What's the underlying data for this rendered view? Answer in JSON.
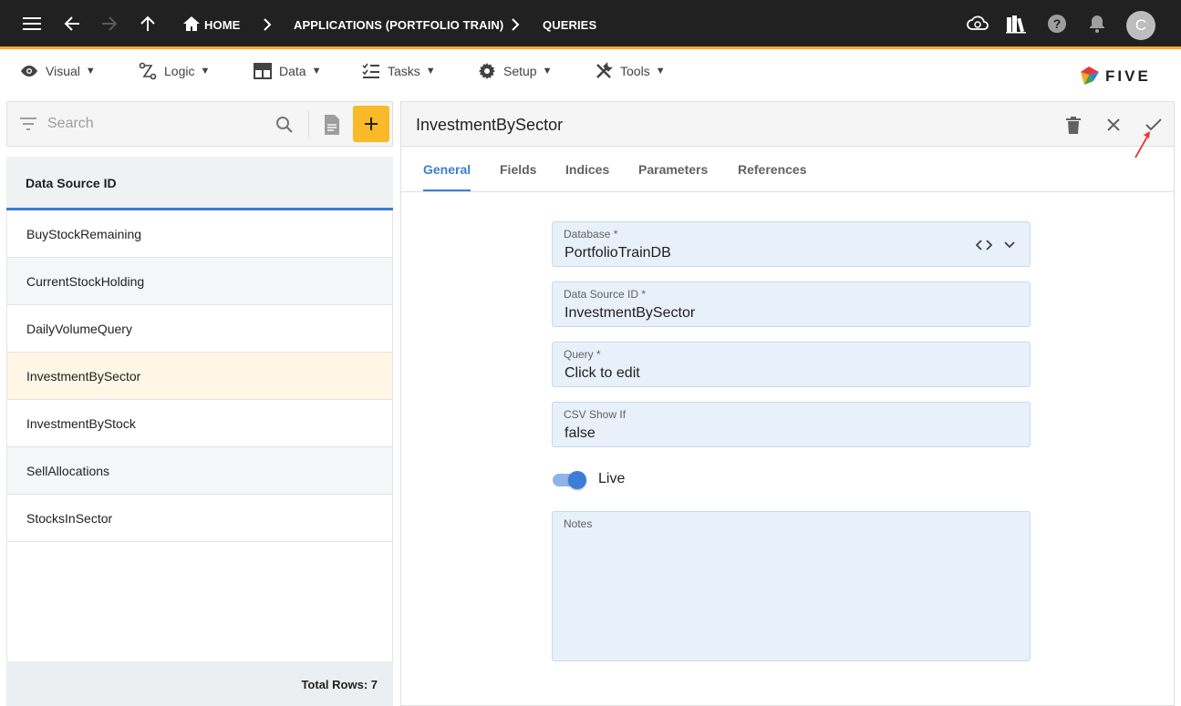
{
  "topbar": {
    "breadcrumbs": [
      "HOME",
      "APPLICATIONS (PORTFOLIO TRAIN)",
      "QUERIES"
    ],
    "avatar_initial": "C"
  },
  "menu": {
    "items": [
      {
        "label": "Visual",
        "icon": "eye-icon"
      },
      {
        "label": "Logic",
        "icon": "logic-icon"
      },
      {
        "label": "Data",
        "icon": "table-icon"
      },
      {
        "label": "Tasks",
        "icon": "tasks-icon"
      },
      {
        "label": "Setup",
        "icon": "gear-icon"
      },
      {
        "label": "Tools",
        "icon": "tools-icon"
      }
    ],
    "caret": "▼",
    "logo_text": "FIVE"
  },
  "sidebar": {
    "search_placeholder": "Search",
    "column_header": "Data Source ID",
    "items": [
      "BuyStockRemaining",
      "CurrentStockHolding",
      "DailyVolumeQuery",
      "InvestmentBySector",
      "InvestmentByStock",
      "SellAllocations",
      "StocksInSector"
    ],
    "selected_index": 3,
    "footer": "Total Rows: 7"
  },
  "detail": {
    "title": "InvestmentBySector",
    "tabs": [
      "General",
      "Fields",
      "Indices",
      "Parameters",
      "References"
    ],
    "active_tab": "General",
    "fields": {
      "database": {
        "label": "Database *",
        "value": "PortfolioTrainDB"
      },
      "data_source_id": {
        "label": "Data Source ID *",
        "value": "InvestmentBySector"
      },
      "query": {
        "label": "Query *",
        "value": "Click to edit"
      },
      "csv_show_if": {
        "label": "CSV Show If",
        "value": "false"
      },
      "notes": {
        "label": "Notes",
        "value": ""
      }
    },
    "live": {
      "label": "Live",
      "on": true
    }
  },
  "colors": {
    "accent": "#3b7dd8",
    "topbar": "#212121",
    "topbar_border": "#f9a825",
    "add_button": "#f9b928",
    "selected_row": "#fff6e5",
    "field_bg": "#e8f0fa",
    "annotation_arrow": "#e53935"
  }
}
